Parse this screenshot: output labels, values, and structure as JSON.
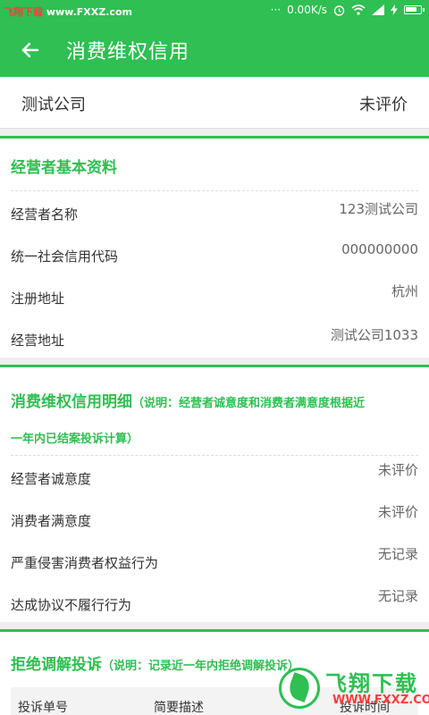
{
  "statusbar": {
    "watermark_red": "飞翔下载",
    "watermark_rest": " www.FXXZ.com",
    "dots": "···",
    "speed": "0.00K/s",
    "alarm_icon": "alarm-icon",
    "wifi_icon": "wifi-icon",
    "signal_icon": "signal-icon",
    "charge_icon": "charging-icon",
    "battery_level": 0.8
  },
  "appbar": {
    "back_icon": "back-arrow-icon",
    "title": "消费维权信用"
  },
  "company": {
    "name": "测试公司",
    "rating": "未评价"
  },
  "basic_info": {
    "title": "经营者基本资料",
    "rows": [
      {
        "label": "经营者名称",
        "value": "123测试公司"
      },
      {
        "label": "统一社会信用代码",
        "value": "000000000"
      },
      {
        "label": "注册地址",
        "value": "杭州"
      },
      {
        "label": "经营地址",
        "value": "测试公司1033"
      }
    ]
  },
  "credit_detail": {
    "title": "消费维权信用明细",
    "note_line1": "（说明：经营者诚意度和消费者满意度根据近",
    "note_line2": "一年内已结案投诉计算）",
    "rows": [
      {
        "label": "经营者诚意度",
        "value": "未评价"
      },
      {
        "label": "消费者满意度",
        "value": "未评价"
      },
      {
        "label": "严重侵害消费者权益行为",
        "value": "无记录"
      },
      {
        "label": "达成协议不履行行为",
        "value": "无记录"
      }
    ]
  },
  "refused": {
    "title": "拒绝调解投诉",
    "note": "（说明：记录近一年内拒绝调解投诉）",
    "columns": [
      "投诉单号",
      "简要描述",
      "投诉时间"
    ]
  },
  "watermark": {
    "big": "飞翔下载",
    "small": "WWW.FXXZ.COM"
  }
}
